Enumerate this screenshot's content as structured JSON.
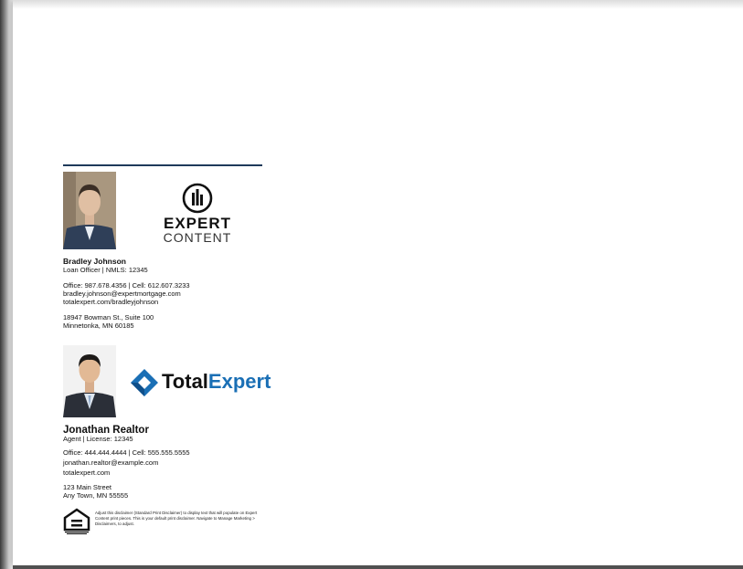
{
  "card1": {
    "name": "Bradley Johnson",
    "title": "Loan Officer | NMLS: 12345",
    "phones": "Office: 987.678.4356 | Cell: 612.607.3233",
    "email": "bradley.johnson@expertmortgage.com",
    "website": "totalexpert.com/bradleyjohnson",
    "address1": "18947 Bowman St., Suite 100",
    "address2": "Minnetonka, MN 60185",
    "logo_line1": "EXPERT",
    "logo_line2": "CONTENT"
  },
  "card2": {
    "name": "Jonathan Realtor",
    "title": "Agent | License: 12345",
    "phones": "Office: 444.444.4444 | Cell: 555.555.5555",
    "email": "jonathan.realtor@example.com",
    "website": "totalexpert.com",
    "address1": "123 Main Street",
    "address2": "Any Town, MN 55555",
    "logo_part1": "Total",
    "logo_part2": "Expert"
  },
  "disclaimer": "Adjust this disclaimer (Standard Print Disclaimer) to display text that will populate on Expert Content print pieces. This is your default print disclaimer. Navigate to Manage Marketing > Disclaimers, to adjust.",
  "colors": {
    "divider": "#1f3a5a",
    "total_blue": "#1a6fb5",
    "expert_blue": "#0f5aa8"
  },
  "icons": [
    "expert-content-logo-icon",
    "total-expert-diamond-icon",
    "equal-housing-lender-icon"
  ]
}
